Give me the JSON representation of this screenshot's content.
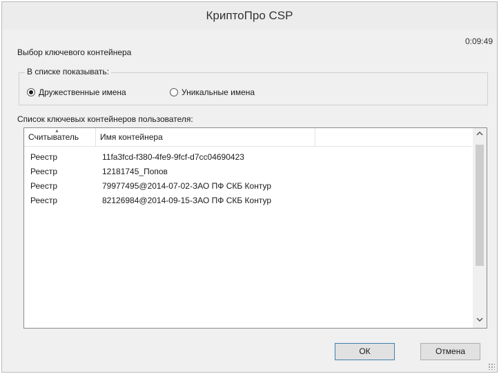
{
  "window": {
    "title": "КриптоПро CSP",
    "timer": "0:09:49"
  },
  "dialog": {
    "caption": "Выбор ключевого контейнера",
    "group": {
      "legend": "В списке показывать:",
      "options": [
        {
          "label": "Дружественные имена",
          "selected": true
        },
        {
          "label": "Уникальные имена",
          "selected": false
        }
      ]
    },
    "list_label": "Список ключевых контейнеров пользователя:",
    "columns": [
      "Считыватель",
      "Имя контейнера"
    ],
    "rows": [
      {
        "reader": "Реестр",
        "name": "11fa3fcd-f380-4fe9-9fcf-d7cc04690423"
      },
      {
        "reader": "Реестр",
        "name": "12181745_Попов"
      },
      {
        "reader": "Реестр",
        "name": "79977495@2014-07-02-ЗАО ПФ СКБ Контур"
      },
      {
        "reader": "Реестр",
        "name": "82126984@2014-09-15-ЗАО ПФ СКБ Контур"
      }
    ],
    "buttons": {
      "ok": "ОК",
      "cancel": "Отмена"
    }
  },
  "icons": {
    "scroll_up": "chevron-up-icon",
    "scroll_down": "chevron-down-icon",
    "sort": "sort-ascending-icon",
    "resize": "resize-grip-icon"
  }
}
